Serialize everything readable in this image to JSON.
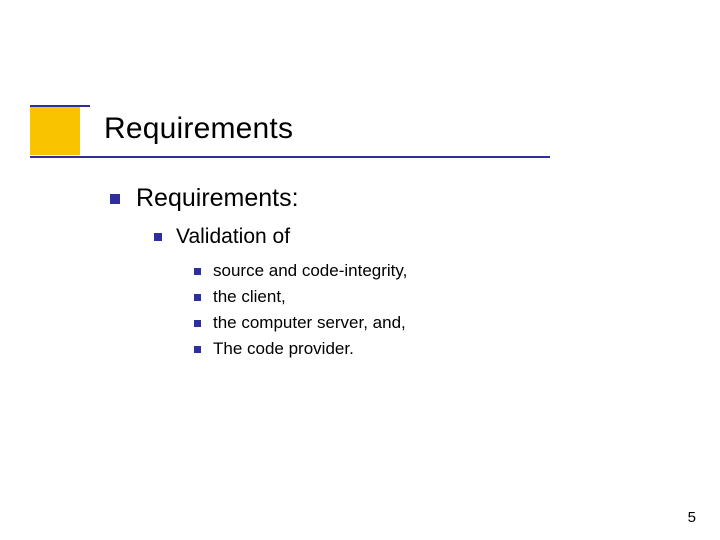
{
  "slide": {
    "title": "Requirements",
    "body": {
      "lvl1": {
        "text": "Requirements:",
        "lvl2": {
          "text": "Validation of",
          "lvl3": [
            "source and code-integrity,",
            "the client,",
            "the computer server, and,",
            "The code provider."
          ]
        }
      }
    },
    "page_number": "5"
  },
  "colors": {
    "accent": "#f9c300",
    "rule": "#2e2e9d",
    "bullet": "#2e2e9d"
  }
}
